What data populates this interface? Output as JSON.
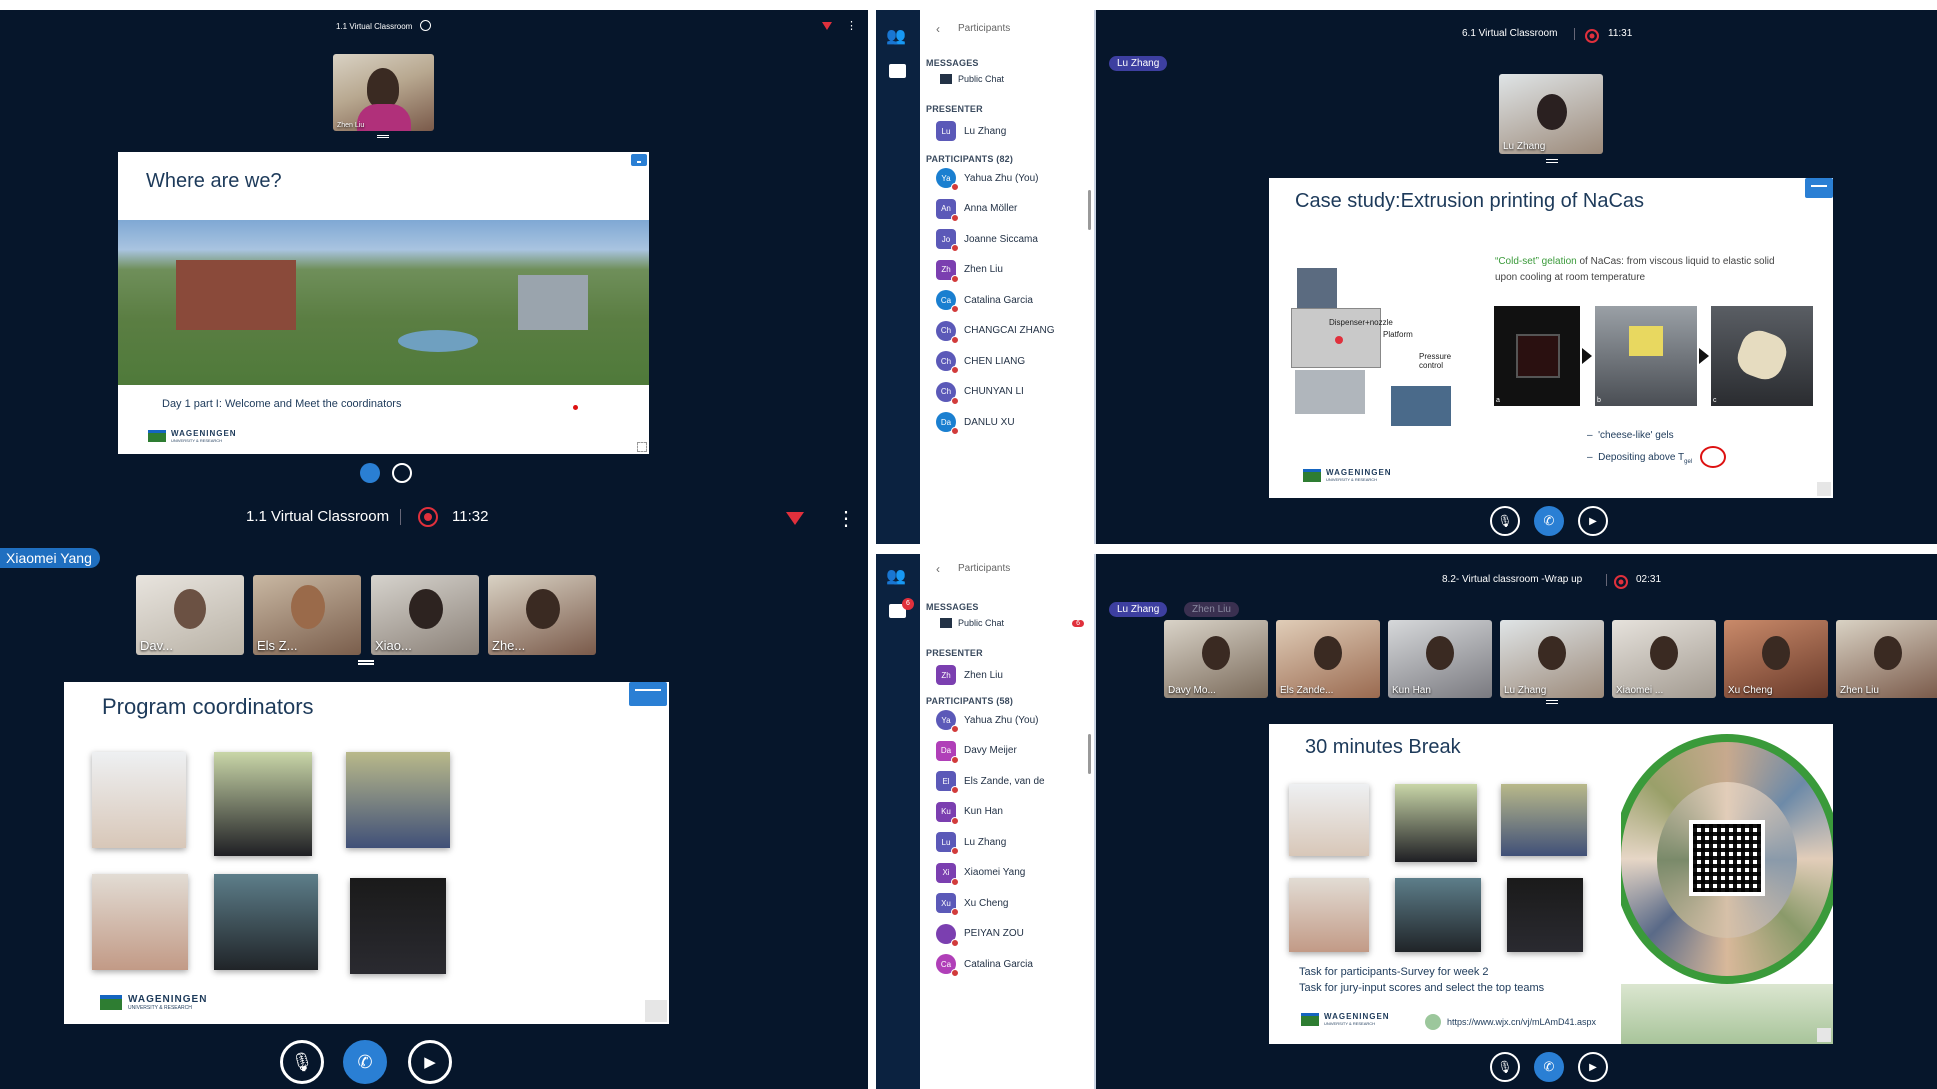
{
  "q1": {
    "top_title": "1.1 Virtual Classroom",
    "presenter_tile_label": "Zhen Liu",
    "slide_title": "Where are we?",
    "slide_caption": "Day 1 part I: Welcome and Meet the coordinators",
    "logo_text": "WAGENINGEN",
    "logo_sub": "UNIVERSITY & RESEARCH"
  },
  "q1b": {
    "bar_title": "1.1 Virtual Classroom",
    "bar_time": "11:32",
    "speaker_badge": "Xiaomei Yang",
    "tiles": [
      "Dav...",
      "Els Z...",
      "Xiao...",
      "Zhe..."
    ],
    "slide_title": "Program coordinators",
    "logo_text": "WAGENINGEN",
    "logo_sub": "UNIVERSITY & RESEARCH"
  },
  "q2": {
    "panel_title": "Participants",
    "messages_label": "MESSAGES",
    "public_chat": "Public Chat",
    "presenter_label": "PRESENTER",
    "presenter": {
      "initials": "Lu",
      "name": "Lu Zhang"
    },
    "participants_label": "PARTICIPANTS (82)",
    "participants": [
      {
        "initials": "Ya",
        "name": "Yahua Zhu (You)",
        "color": "#1a7fd0",
        "round": true
      },
      {
        "initials": "An",
        "name": "Anna Möller",
        "color": "#5b59b8",
        "round": false
      },
      {
        "initials": "Jo",
        "name": "Joanne Siccama",
        "color": "#5b59b8",
        "round": false
      },
      {
        "initials": "Zh",
        "name": "Zhen Liu",
        "color": "#7b3fb0",
        "round": false
      },
      {
        "initials": "Ca",
        "name": "Catalina Garcia",
        "color": "#1a7fd0",
        "round": true
      },
      {
        "initials": "Ch",
        "name": "CHANGCAI ZHANG",
        "color": "#5b59b8",
        "round": true
      },
      {
        "initials": "Ch",
        "name": "CHEN LIANG",
        "color": "#5b59b8",
        "round": true
      },
      {
        "initials": "Ch",
        "name": "CHUNYAN LI",
        "color": "#5b59b8",
        "round": true
      },
      {
        "initials": "Da",
        "name": "DANLU XU",
        "color": "#1a7fd0",
        "round": true
      }
    ],
    "top_title": "6.1 Virtual Classroom",
    "top_time": "11:31",
    "speaker_badge": "Lu Zhang",
    "tile_label": "Lu Zhang",
    "slide_title": "Case study:Extrusion printing of NaCas",
    "gel_heading_colored": "“Cold-set” gelation",
    "gel_heading_rest": " of NaCas: from viscous liquid to elastic solid upon cooling at room temperature",
    "diagram_labels": [
      "Dispenser+nozzle",
      "Platform",
      "Pressure control"
    ],
    "bullets": [
      "'cheese-like' gels",
      "Depositing above T"
    ],
    "bullet_sub": "gel",
    "panel_letters": [
      "a",
      "b",
      "c"
    ],
    "logo_text": "WAGENINGEN",
    "logo_sub": "UNIVERSITY & RESEARCH"
  },
  "q3": {
    "panel_title": "Participants",
    "chat_badge": "6",
    "messages_label": "MESSAGES",
    "public_chat": "Public Chat",
    "public_chat_badge": "6",
    "presenter_label": "PRESENTER",
    "presenter": {
      "initials": "Zh",
      "name": "Zhen Liu"
    },
    "participants_label": "PARTICIPANTS (58)",
    "participants": [
      {
        "initials": "Ya",
        "name": "Yahua Zhu (You)",
        "color": "#5b59b8",
        "round": true
      },
      {
        "initials": "Da",
        "name": "Davy Meijer",
        "color": "#b03fb8",
        "round": false
      },
      {
        "initials": "El",
        "name": "Els Zande, van de",
        "color": "#5b59b8",
        "round": false
      },
      {
        "initials": "Ku",
        "name": "Kun Han",
        "color": "#7b3fb0",
        "round": false
      },
      {
        "initials": "Lu",
        "name": "Lu Zhang",
        "color": "#5b59b8",
        "round": false
      },
      {
        "initials": "Xi",
        "name": "Xiaomei Yang",
        "color": "#7b3fb0",
        "round": false
      },
      {
        "initials": "Xu",
        "name": "Xu Cheng",
        "color": "#5b59b8",
        "round": false
      },
      {
        "initials": "",
        "name": "PEIYAN ZOU",
        "color": "#7b3fb0",
        "round": true
      },
      {
        "initials": "Ca",
        "name": "Catalina Garcia",
        "color": "#b03fb8",
        "round": true
      }
    ],
    "top_title": "8.2- Virtual classroom -Wrap up",
    "top_time": "02:31",
    "speaker_badges": [
      "Lu Zhang",
      "Zhen Liu"
    ],
    "tiles": [
      "Davy Mo...",
      "Els Zande...",
      "Kun Han",
      "Lu Zhang",
      "Xiaomei ...",
      "Xu Cheng",
      "Zhen Liu"
    ],
    "slide_title": "30 minutes Break",
    "task_1": "Task for participants-Survey for week 2",
    "task_2": "Task for jury-input scores and select the top teams",
    "url": "https://www.wjx.cn/vj/mLAmD41.aspx",
    "logo_text": "WAGENINGEN",
    "logo_sub": "UNIVERSITY & RESEARCH"
  },
  "colors": {
    "bg_dark": "#06162b",
    "accent_blue": "#2a7fd4",
    "record_red": "#e0303c",
    "slide_title": "#1d3a5a",
    "wur_green": "#2e7d32"
  }
}
